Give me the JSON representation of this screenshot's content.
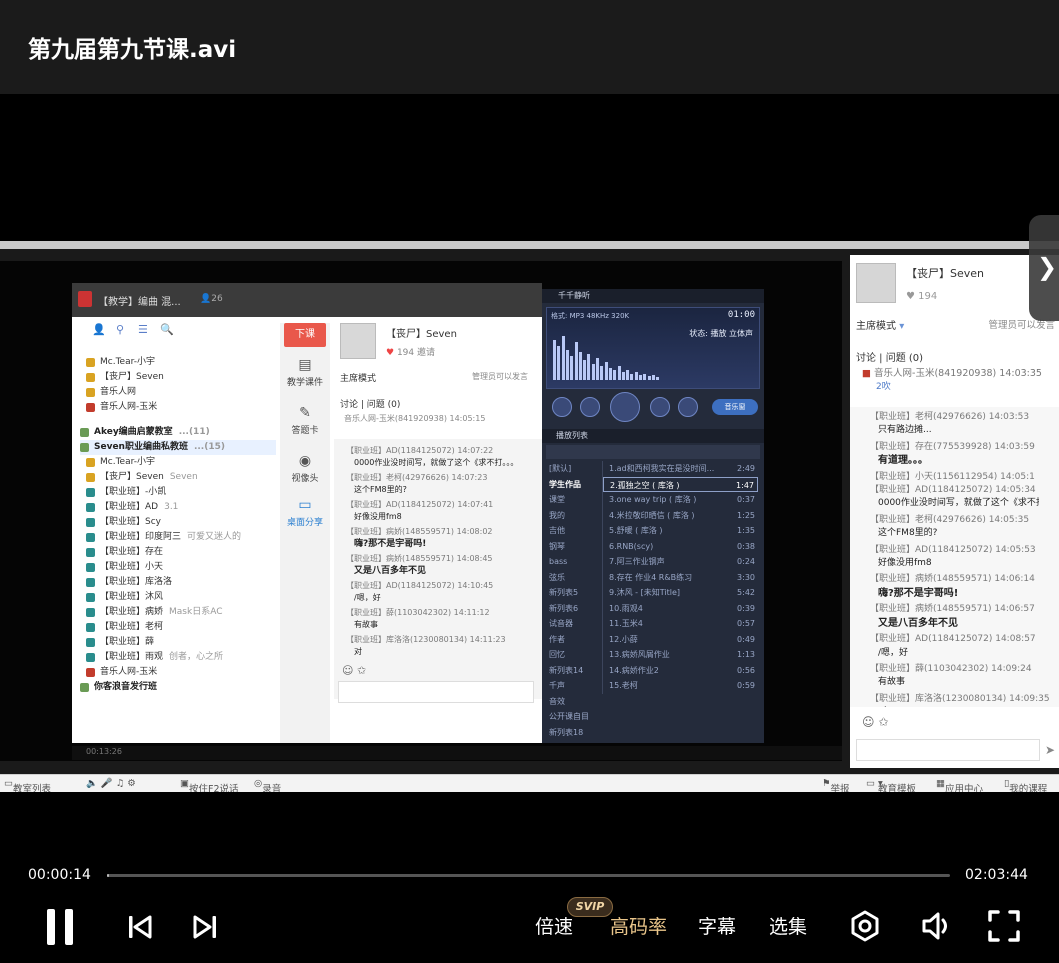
{
  "video": {
    "title": "第九届第九节课.avi"
  },
  "playback": {
    "current_time": "00:00:14",
    "total_time": "02:03:44",
    "progress_fraction": 0.0019,
    "speed_label": "倍速",
    "quality_label": "高码率",
    "quality_badge": "SVIP",
    "subtitle_label": "字幕",
    "episodes_label": "选集"
  },
  "colors": {
    "accent_gold": "#e9c58a",
    "badge_bg": "#3a2c1d",
    "progress_bg": "#555555"
  },
  "frame": {
    "client": {
      "room": "【教学】编曲 混...",
      "count": "26",
      "tree": [
        {
          "label": "Mc.Tear-小宇",
          "type": "user"
        },
        {
          "label": "【丧尸】Seven",
          "type": "user"
        },
        {
          "label": "音乐人网",
          "type": "user"
        },
        {
          "label": "音乐人网-玉米",
          "type": "red"
        },
        {
          "label": "Akey编曲启蒙教室",
          "type": "chan",
          "tag": "...(11)"
        },
        {
          "label": "Seven职业编曲私教班",
          "type": "chan",
          "tag": "...(15)"
        },
        {
          "label": "Mc.Tear-小宇",
          "type": "user"
        },
        {
          "label": "【丧尸】Seven",
          "type": "user",
          "tag": "Seven"
        },
        {
          "label": "【职业班】-小凯",
          "type": "member"
        },
        {
          "label": "【职业班】AD",
          "type": "member",
          "tag": "3.1"
        },
        {
          "label": "【职业班】Scy",
          "type": "member"
        },
        {
          "label": "【职业班】印度阿三",
          "type": "member",
          "tag": "可爱又迷人的"
        },
        {
          "label": "【职业班】存在",
          "type": "member"
        },
        {
          "label": "【职业班】小天",
          "type": "member"
        },
        {
          "label": "【职业班】库洛洛",
          "type": "member"
        },
        {
          "label": "【职业班】沐风",
          "type": "member"
        },
        {
          "label": "【职业班】病娇",
          "type": "member",
          "tag": "Mask日系AC"
        },
        {
          "label": "【职业班】老柯",
          "type": "member"
        },
        {
          "label": "【职业班】薛",
          "type": "member"
        },
        {
          "label": "【职业班】雨观",
          "type": "member",
          "tag": "创者，心之所"
        },
        {
          "label": "音乐人网-玉米",
          "type": "red"
        },
        {
          "label": "你客浪音发行班",
          "type": "chan"
        }
      ],
      "side": {
        "end_class": "下课",
        "items": [
          "教学课件",
          "答题卡",
          "视像头",
          "桌面分享"
        ]
      },
      "chat": {
        "name": "【丧尸】Seven",
        "likes": "194 邀请",
        "mode": "主席模式",
        "admin": "管理员可以发言",
        "disc": "讨论 | 问题 (0)",
        "sys": "音乐人网-玉米(841920938) 14:05:15",
        "messages": [
          {
            "meta": "【职业班】AD(1184125072) 14:07:22",
            "text": "0000作业没时间写，就做了这个《求不打。。。",
            "bold": false
          },
          {
            "meta": "【职业班】老柯(42976626) 14:07:23",
            "text": "这个FM8里的?",
            "bold": false
          },
          {
            "meta": "【职业班】AD(1184125072) 14:07:41",
            "text": "好像没用fm8",
            "bold": false
          },
          {
            "meta": "【职业班】病娇(148559571) 14:08:02",
            "text": "嗨?那不是宇哥吗!",
            "bold": true
          },
          {
            "meta": "【职业班】病娇(148559571) 14:08:45",
            "text": "又是八百多年不见",
            "bold": true
          },
          {
            "meta": "【职业班】AD(1184125072) 14:10:45",
            "text": "/嗯，好",
            "bold": false
          },
          {
            "meta": "【职业班】薛(1103042302) 14:11:12",
            "text": "有故事",
            "bold": false
          },
          {
            "meta": "【职业班】库洛洛(1230080134) 14:11:23",
            "text": "对",
            "bold": false
          }
        ]
      }
    },
    "player": {
      "title": "千千静听",
      "format": "格式: MP3 48KHz 320K",
      "time": "01:00",
      "state": "状态: 播放  立体声",
      "music_btn": "音乐窗",
      "playlist_title": "播放列表",
      "categories": [
        "[默认]",
        "学生作品",
        "课堂",
        "我的",
        "吉他",
        "钢琴",
        "bass",
        "弦乐",
        "新列表5",
        "新列表6",
        "试音器",
        "作者",
        "回忆",
        "新列表14",
        "千声",
        "音效",
        "公开课自目",
        "新列表18"
      ],
      "tracks": [
        {
          "label": "1.ad和西柯我实在是没时间...",
          "dur": "2:49"
        },
        {
          "label": "2.孤独之空 ( 库洛 )",
          "dur": "1:47",
          "on": true
        },
        {
          "label": "3.one way trip ( 库洛 )",
          "dur": "0:37"
        },
        {
          "label": "4.米拉敬印晒信 ( 库洛 )",
          "dur": "1:25"
        },
        {
          "label": "5.舒暖 ( 库洛 )",
          "dur": "1:35"
        },
        {
          "label": "6.RNB(scy)",
          "dur": "0:38"
        },
        {
          "label": "7.阿三作业钢声",
          "dur": "0:24"
        },
        {
          "label": "8.存在 作业4 R&B练习",
          "dur": "3:30"
        },
        {
          "label": "9.沐风 - [未知Title]",
          "dur": "5:42"
        },
        {
          "label": "10.雨观4",
          "dur": "0:39"
        },
        {
          "label": "11.玉米4",
          "dur": "0:57"
        },
        {
          "label": "12.小薛",
          "dur": "0:49"
        },
        {
          "label": "13.病娇风屑作业",
          "dur": "1:13"
        },
        {
          "label": "14.病娇作业2",
          "dur": "0:56"
        },
        {
          "label": "15.老柯",
          "dur": "0:59"
        }
      ]
    },
    "cap_time": "00:13:26",
    "right_chat": {
      "name": "【丧尸】Seven",
      "likes": "194",
      "mode": "主席模式",
      "admin": "管理员可以发言",
      "disc": "讨论 | 问题 (0)",
      "sys": "音乐人网-玉米(841920938) 14:03:35",
      "sys2": "2吹",
      "messages": [
        {
          "meta": "【职业班】老柯(42976626) 14:03:53",
          "text": "只有路边摊...",
          "bold": false
        },
        {
          "meta": "【职业班】存在(775539928) 14:03:59",
          "text": "有道理。。。",
          "bold": true
        },
        {
          "meta": "【职业班】小天(1156112954) 14:05:1",
          "text": "",
          "bold": false
        },
        {
          "meta": "【职业班】AD(1184125072) 14:05:34",
          "text": "0000作业没时间写，就做了这个《求不打",
          "bold": false
        },
        {
          "meta": "【职业班】老柯(42976626) 14:05:35",
          "text": "这个FM8里的?",
          "bold": false
        },
        {
          "meta": "【职业班】AD(1184125072) 14:05:53",
          "text": "好像没用fm8",
          "bold": false
        },
        {
          "meta": "【职业班】病娇(148559571) 14:06:14",
          "text": "嗨?那不是宇哥吗!",
          "bold": true
        },
        {
          "meta": "【职业班】病娇(148559571) 14:06:57",
          "text": "又是八百多年不见",
          "bold": true
        },
        {
          "meta": "【职业班】AD(1184125072) 14:08:57",
          "text": "/嗯，好",
          "bold": false
        },
        {
          "meta": "【职业班】薛(1103042302) 14:09:24",
          "text": "有故事",
          "bold": false
        },
        {
          "meta": "【职业班】库洛洛(1230080134) 14:09:35",
          "text": "对",
          "bold": false
        }
      ]
    },
    "footer": {
      "items": [
        "教室列表",
        "按住F2说话",
        "录音"
      ],
      "right_items": [
        "举报",
        "教育模板",
        "应用中心",
        "我的课程"
      ]
    }
  }
}
